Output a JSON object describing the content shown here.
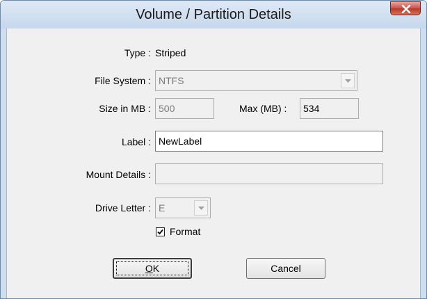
{
  "window": {
    "title": "Volume / Partition Details"
  },
  "form": {
    "type": {
      "label": "Type :",
      "value": "Striped"
    },
    "file_system": {
      "label": "File System :",
      "value": "NTFS"
    },
    "size": {
      "label": "Size in MB :",
      "value": "500"
    },
    "max": {
      "label": "Max (MB) :",
      "value": "534"
    },
    "volume_label": {
      "label": "Label :",
      "value": "NewLabel"
    },
    "mount_details": {
      "label": "Mount Details :",
      "value": ""
    },
    "drive_letter": {
      "label": "Drive Letter :",
      "value": "E"
    },
    "format": {
      "label": "Format",
      "checked": true
    }
  },
  "buttons": {
    "ok_first": "O",
    "ok_rest": "K",
    "cancel": "Cancel"
  },
  "icons": {
    "close": "close-icon",
    "dropdown": "chevron-down-icon",
    "check": "checkmark-icon"
  }
}
